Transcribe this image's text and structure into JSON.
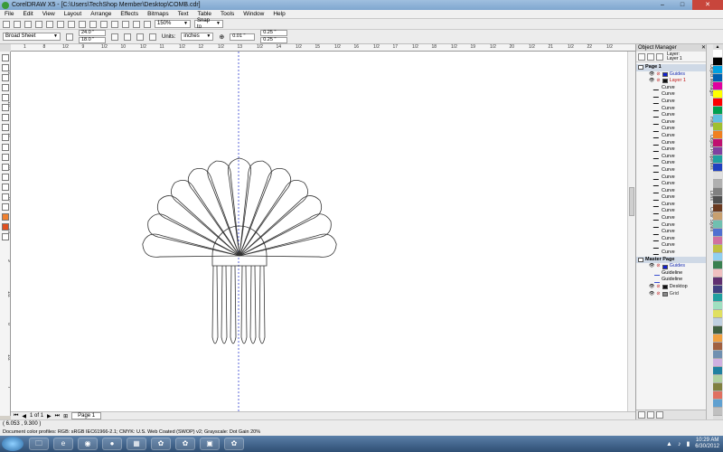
{
  "window": {
    "title": "CorelDRAW X5 - [C:\\Users\\TechShop Member\\Desktop\\COMB.cdr]",
    "controls": [
      "–",
      "□",
      "✕"
    ]
  },
  "menu": [
    "File",
    "Edit",
    "View",
    "Layout",
    "Arrange",
    "Effects",
    "Bitmaps",
    "Text",
    "Table",
    "Tools",
    "Window",
    "Help"
  ],
  "standard_toolbar": {
    "zoom": "150%",
    "snap_to": "Snap to"
  },
  "property_bar": {
    "paper": "Broad Sheet",
    "width": "24.0 \"",
    "height": "18.0 \"",
    "units_label": "Units:",
    "units_value": "inches",
    "nudge": "0.01 \"",
    "dup_x": "0.25 \"",
    "dup_y": "0.25 \""
  },
  "rulers": {
    "top_labels": [
      "1",
      "8",
      "1/2",
      "9",
      "1/2",
      "10",
      "1/2",
      "11",
      "1/2",
      "12",
      "1/2",
      "13",
      "1/2",
      "14",
      "1/2",
      "15",
      "1/2",
      "16",
      "1/2",
      "17",
      "1/2",
      "18",
      "1/2",
      "19",
      "1/2",
      "20",
      "1/2",
      "21",
      "1/2",
      "22",
      "1/2"
    ],
    "left_labels": [
      "12",
      "1/2",
      "11",
      "1/2",
      "10",
      "1/2",
      "9",
      "1/2",
      "8",
      "1/2",
      "7"
    ]
  },
  "page_nav": {
    "counter": "1 of 1",
    "page_tab": "Page 1"
  },
  "status": {
    "cursor": "( 6.053 , 9.300 )",
    "profiles": "Document color profiles: RGB: sRGB IEC61966-2.1; CMYK: U.S. Web Coated (SWOP) v2; Grayscale: Dot Gain 20%"
  },
  "docker": {
    "title": "Object Manager",
    "layer_label": "Layer:",
    "layer_value": "Layer 1",
    "tree": [
      {
        "label": "Page 1",
        "kind": "section",
        "indent": 0
      },
      {
        "label": "Guides",
        "kind": "layer",
        "indent": 2,
        "color": "#1020d0",
        "text_color": "#1a2fb5"
      },
      {
        "label": "Layer 1",
        "kind": "layer",
        "indent": 2,
        "color": "#111111",
        "text_color": "#c01010"
      },
      {
        "label": "Curve",
        "kind": "curve",
        "indent": 3
      },
      {
        "label": "Curve",
        "kind": "curve",
        "indent": 3
      },
      {
        "label": "Curve",
        "kind": "curve",
        "indent": 3
      },
      {
        "label": "Curve",
        "kind": "curve",
        "indent": 3
      },
      {
        "label": "Curve",
        "kind": "curve",
        "indent": 3
      },
      {
        "label": "Curve",
        "kind": "curve",
        "indent": 3
      },
      {
        "label": "Curve",
        "kind": "curve",
        "indent": 3
      },
      {
        "label": "Curve",
        "kind": "curve",
        "indent": 3
      },
      {
        "label": "Curve",
        "kind": "curve",
        "indent": 3
      },
      {
        "label": "Curve",
        "kind": "curve",
        "indent": 3
      },
      {
        "label": "Curve",
        "kind": "curve",
        "indent": 3
      },
      {
        "label": "Curve",
        "kind": "curve",
        "indent": 3
      },
      {
        "label": "Curve",
        "kind": "curve",
        "indent": 3
      },
      {
        "label": "Curve",
        "kind": "curve",
        "indent": 3
      },
      {
        "label": "Curve",
        "kind": "curve",
        "indent": 3
      },
      {
        "label": "Curve",
        "kind": "curve",
        "indent": 3
      },
      {
        "label": "Curve",
        "kind": "curve",
        "indent": 3
      },
      {
        "label": "Curve",
        "kind": "curve",
        "indent": 3
      },
      {
        "label": "Curve",
        "kind": "curve",
        "indent": 3
      },
      {
        "label": "Curve",
        "kind": "curve",
        "indent": 3
      },
      {
        "label": "Curve",
        "kind": "curve",
        "indent": 3
      },
      {
        "label": "Curve",
        "kind": "curve",
        "indent": 3
      },
      {
        "label": "Curve",
        "kind": "curve",
        "indent": 3
      },
      {
        "label": "Curve",
        "kind": "curve",
        "indent": 3
      },
      {
        "label": "Curve",
        "kind": "curve",
        "indent": 3
      },
      {
        "label": "Master Page",
        "kind": "section",
        "indent": 0
      },
      {
        "label": "Guides",
        "kind": "layer",
        "indent": 2,
        "color": "#1020d0",
        "text_color": "#1a2fb5"
      },
      {
        "label": "Guideline",
        "kind": "guide",
        "indent": 3
      },
      {
        "label": "Guideline",
        "kind": "guide",
        "indent": 3
      },
      {
        "label": "Desktop",
        "kind": "layer",
        "indent": 2,
        "color": "#111111",
        "text_color": "#111111"
      },
      {
        "label": "Grid",
        "kind": "layer",
        "indent": 2,
        "color": "#888888",
        "text_color": "#333333"
      }
    ]
  },
  "side_tabs": [
    "Object Manager",
    "Hints",
    "Object Properties",
    "Lens",
    "Color Styles"
  ],
  "palette": [
    "#ffffff",
    "#000000",
    "#00a0e0",
    "#0060b0",
    "#e000a0",
    "#ffff00",
    "#ff0000",
    "#00a050",
    "#60c0e0",
    "#a0c030",
    "#f08020",
    "#c01070",
    "#8040a0",
    "#20a0a0",
    "#2040c0",
    "#e0e0e0",
    "#b0b0b0",
    "#808080",
    "#505050",
    "#6a3a20",
    "#c8a070",
    "#70c0b0",
    "#5070d0",
    "#d070a0",
    "#c0c040",
    "#90d0f0",
    "#3a8050",
    "#f0c0c0",
    "#603070",
    "#404080",
    "#20a0a0",
    "#a0e0c0",
    "#e0e060",
    "#c0d0e0",
    "#406040",
    "#f0a040",
    "#a06040",
    "#7090b0",
    "#d0b0e0",
    "#2080a0",
    "#b0d0a0",
    "#808040",
    "#e07060",
    "#60a0d0",
    "#c0c0c0"
  ],
  "taskbar": {
    "apps": [
      "explorer",
      "ie",
      "chrome",
      "firefox",
      "apps",
      "corel",
      "corel-draw",
      "photo",
      "corel-x5"
    ],
    "time": "10:29 AM",
    "date": "6/30/2012"
  }
}
